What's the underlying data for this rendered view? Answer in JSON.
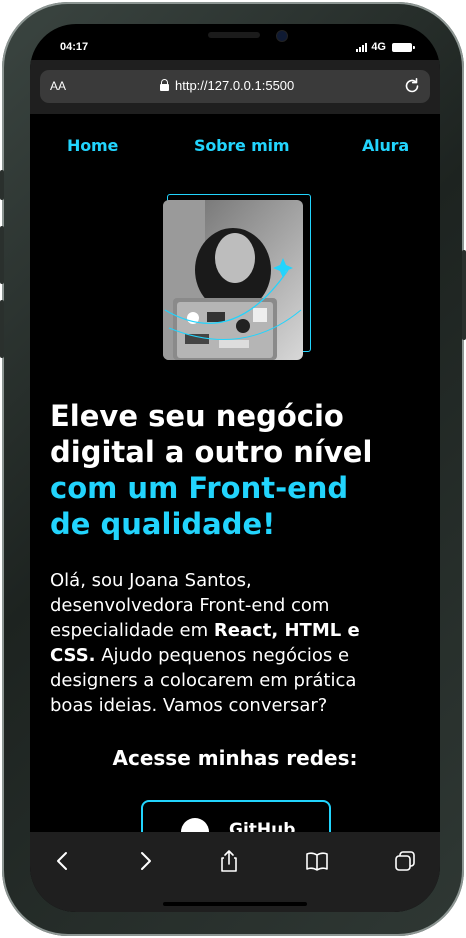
{
  "status_bar": {
    "time": "04:17",
    "network": "4G"
  },
  "browser": {
    "text_size_label": "AA",
    "url": "http://127.0.0.1:5500"
  },
  "nav": {
    "home": "Home",
    "about": "Sobre mim",
    "alura": "Alura"
  },
  "hero": {
    "headline_line1": "Eleve seu negócio",
    "headline_line2": "digital a outro nível",
    "headline_accent_line1": "com um Front-end",
    "headline_accent_line2": "de qualidade!",
    "intro_part1": "Olá, sou Joana Santos, desenvolvedora Front-end com especialidade em ",
    "intro_bold": "React, HTML e CSS.",
    "intro_part2": " Ajudo pequenos negócios e designers a colocarem em prática boas ideias. Vamos conversar?"
  },
  "social": {
    "title": "Acesse minhas redes:",
    "github_label": "GitHub"
  },
  "colors": {
    "accent": "#22d4fd",
    "background": "#000000",
    "toolbar": "#1f1f1f"
  },
  "toolbar_icons": [
    "back-icon",
    "forward-icon",
    "share-icon",
    "bookmarks-icon",
    "tabs-icon"
  ]
}
